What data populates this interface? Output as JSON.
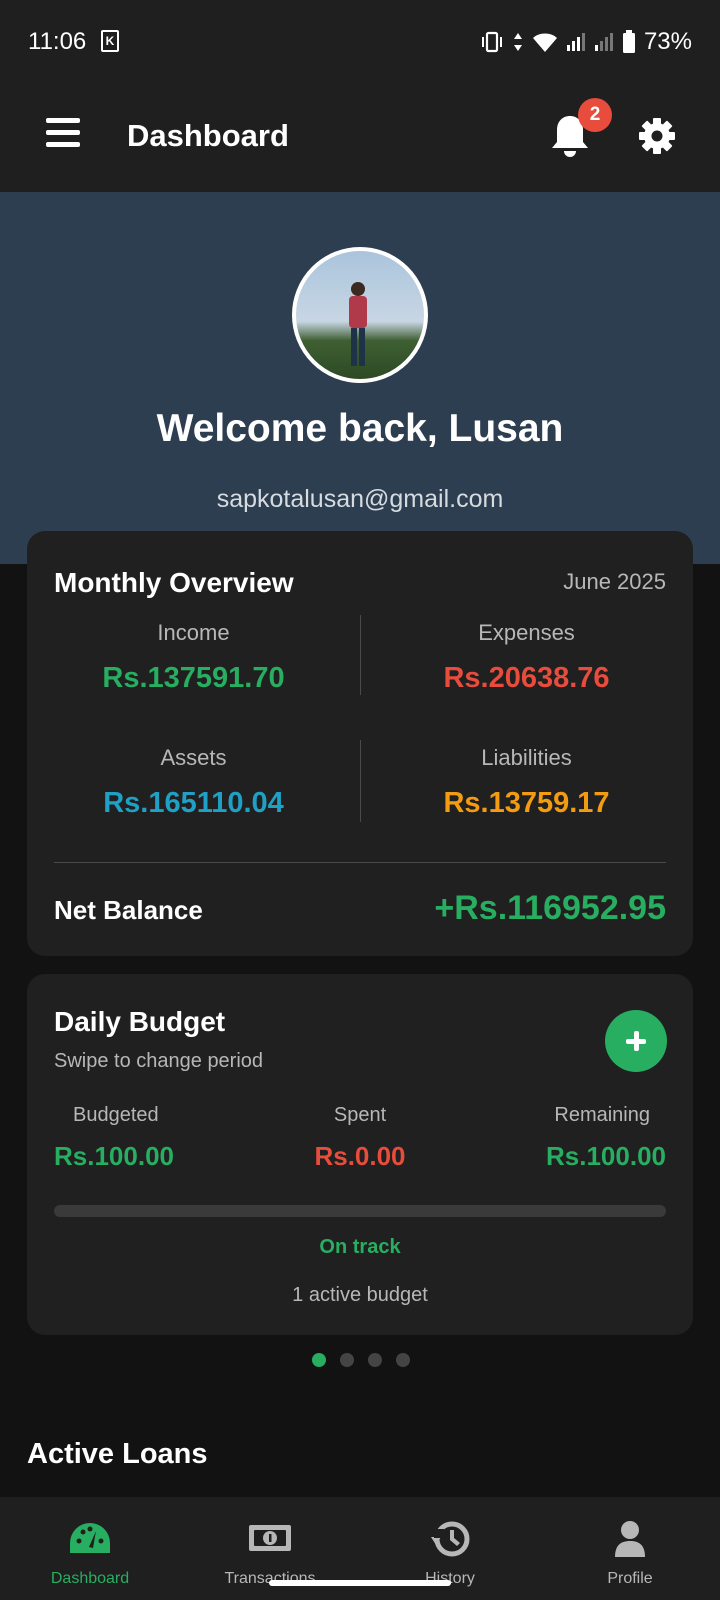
{
  "status_bar": {
    "time": "11:06",
    "battery": "73%"
  },
  "app_bar": {
    "title": "Dashboard",
    "notification_count": "2"
  },
  "header": {
    "welcome": "Welcome back, Lusan",
    "email": "sapkotalusan@gmail.com"
  },
  "overview": {
    "title": "Monthly Overview",
    "period": "June 2025",
    "stats": [
      {
        "label": "Income",
        "value": "Rs.137591.70",
        "color": "#27ae60"
      },
      {
        "label": "Expenses",
        "value": "Rs.20638.76",
        "color": "#e74c3c"
      },
      {
        "label": "Assets",
        "value": "Rs.165110.04",
        "color": "#1fa0c4"
      },
      {
        "label": "Liabilities",
        "value": "Rs.13759.17",
        "color": "#f39c12"
      }
    ],
    "net_label": "Net Balance",
    "net_value": "+Rs.116952.95"
  },
  "budget": {
    "title": "Daily Budget",
    "subtitle": "Swipe to change period",
    "budgeted_label": "Budgeted",
    "budgeted_value": "Rs.100.00",
    "spent_label": "Spent",
    "spent_value": "Rs.0.00",
    "remaining_label": "Remaining",
    "remaining_value": "Rs.100.00",
    "progress_fraction": 0,
    "status": "On track",
    "active_count": "1 active budget"
  },
  "pager": {
    "total": 4,
    "active": 0
  },
  "active_loans": {
    "title": "Active Loans"
  },
  "nav": {
    "items": [
      {
        "label": "Dashboard",
        "icon": "speedometer-icon"
      },
      {
        "label": "Transactions",
        "icon": "money-icon"
      },
      {
        "label": "History",
        "icon": "history-icon"
      },
      {
        "label": "Profile",
        "icon": "person-icon"
      }
    ],
    "active": 0
  },
  "colors": {
    "accent": "#27ae60",
    "header_bg": "#2d3e50",
    "card_bg": "#202020",
    "danger": "#e74c3c"
  }
}
